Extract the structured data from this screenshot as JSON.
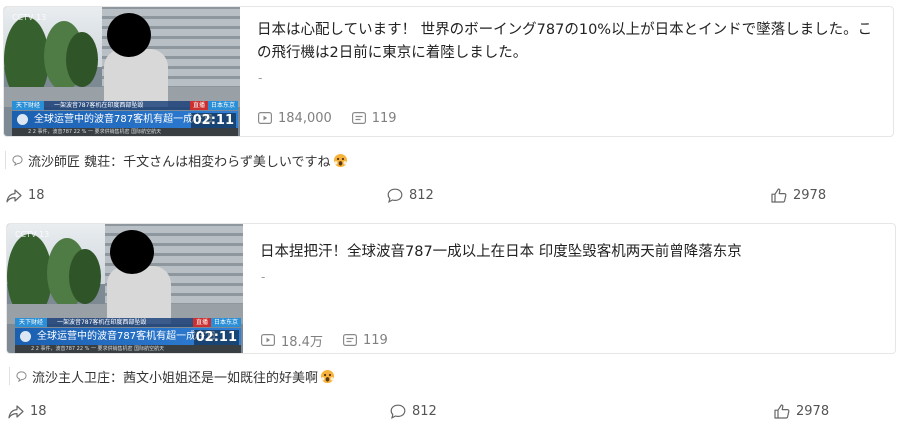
{
  "posts": [
    {
      "thumbnail": {
        "channel_logo": "CCTV 13",
        "live_tag": "天下财经",
        "live_bar_text": "一架波音787客机在印度西部坠毁",
        "live_label": "直播",
        "location": "日本东京",
        "headline": "全球运营中的波音787客机有超一成在日",
        "ticker": "2 2 事件，波音787 22 %    一 要求供销售机密   国际航空航天",
        "duration": "02:11"
      },
      "title": "日本は心配しています！ 世界のボーイング787の10%以上が日本とインドで墜落しました。この飛行機は2日前に東京に着陸しました。",
      "description": "-",
      "views": "184,000",
      "danmaku": "119",
      "comment": {
        "author": "流沙師匠 魏荘：",
        "text": "千文さんは相変わらず美しいですね",
        "emoji": "shocked-face"
      },
      "share_count": "18",
      "comment_count": "812",
      "like_count": "2978"
    },
    {
      "thumbnail": {
        "channel_logo": "CCTV 13",
        "live_tag": "天下财经",
        "live_bar_text": "一架波音787客机在印度西部坠毁",
        "live_label": "直播",
        "location": "日本东京",
        "headline": "全球运营中的波音787客机有超一成在日",
        "ticker": "2 2 事件，波音787 22 %    一 要求供销售机密   国际航空航天",
        "duration": "02:11"
      },
      "title": "日本捏把汗！全球波音787一成以上在日本 印度坠毁客机两天前曾降落东京",
      "description": "-",
      "views": "18.4万",
      "danmaku": "119",
      "comment": {
        "author": "流沙主人卫庄：",
        "text": "茜文小姐姐还是一如既往的好美啊",
        "emoji": "shocked-face"
      },
      "share_count": "18",
      "comment_count": "812",
      "like_count": "2978"
    }
  ]
}
